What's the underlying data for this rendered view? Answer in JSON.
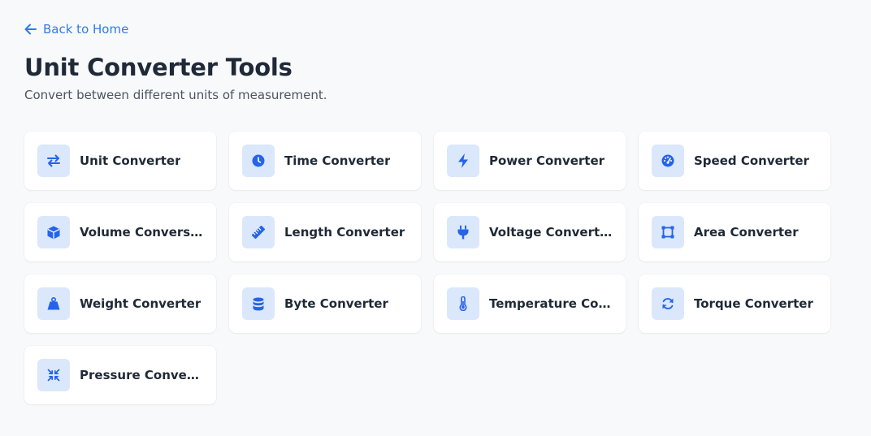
{
  "nav": {
    "back_label": "Back to Home",
    "back_icon": "arrow-left-icon"
  },
  "header": {
    "title": "Unit Converter Tools",
    "subtitle": "Convert between different units of measurement."
  },
  "colors": {
    "accent": "#2f7de1",
    "icon_bg": "#dbe7fb",
    "icon_fg": "#2563eb",
    "page_bg": "#f8f9fb",
    "card_bg": "#ffffff",
    "title": "#1f2937"
  },
  "tools": [
    {
      "label": "Unit Converter",
      "icon": "arrows-exchange-icon"
    },
    {
      "label": "Time Converter",
      "icon": "clock-icon"
    },
    {
      "label": "Power Converter",
      "icon": "lightning-bolt-icon"
    },
    {
      "label": "Speed Converter",
      "icon": "speedometer-icon"
    },
    {
      "label": "Volume Conversion",
      "icon": "cube-icon"
    },
    {
      "label": "Length Converter",
      "icon": "ruler-icon"
    },
    {
      "label": "Voltage Converter",
      "icon": "plug-icon"
    },
    {
      "label": "Area Converter",
      "icon": "vector-square-icon"
    },
    {
      "label": "Weight Converter",
      "icon": "weight-icon"
    },
    {
      "label": "Byte Converter",
      "icon": "database-icon"
    },
    {
      "label": "Temperature Conv...",
      "icon": "thermometer-icon"
    },
    {
      "label": "Torque Converter",
      "icon": "rotate-icon"
    },
    {
      "label": "Pressure Conversion",
      "icon": "compress-icon"
    }
  ]
}
